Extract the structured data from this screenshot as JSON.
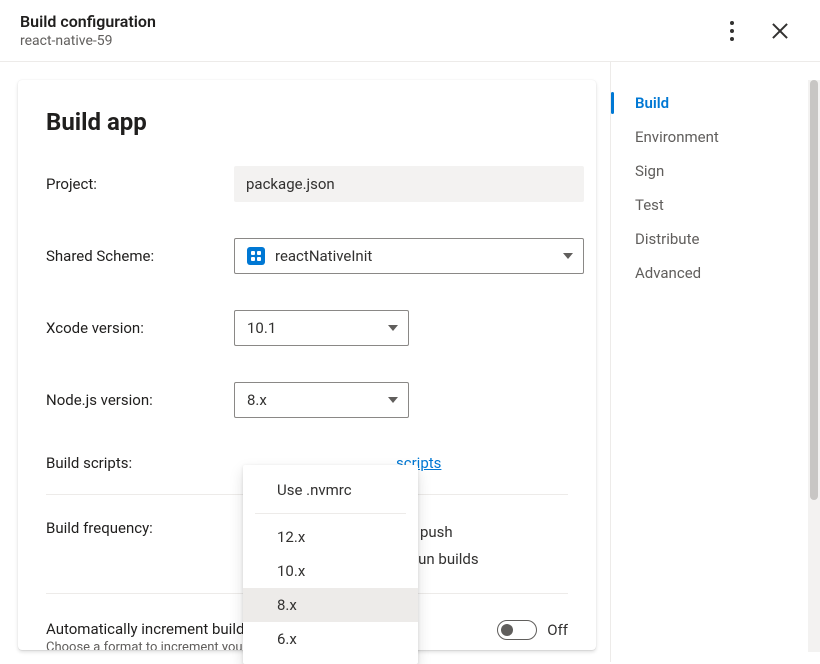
{
  "header": {
    "title": "Build configuration",
    "subtitle": "react-native-59"
  },
  "page": {
    "heading": "Build app"
  },
  "form": {
    "project": {
      "label": "Project:",
      "value": "package.json"
    },
    "shared_scheme": {
      "label": "Shared Scheme:",
      "value": "reactNativeInit"
    },
    "xcode_version": {
      "label": "Xcode version:",
      "value": "10.1"
    },
    "nodejs_version": {
      "label": "Node.js version:",
      "value": "8.x"
    },
    "build_scripts": {
      "label": "Build scripts:",
      "link_partial": "scripts"
    },
    "build_frequency": {
      "label": "Build frequency:",
      "line1_partial": "ery push",
      "line2_partial": "to run builds"
    },
    "auto_increment": {
      "title": "Automatically increment build number",
      "subtitle": "Choose a format to increment your builds.",
      "state": "Off"
    }
  },
  "nodejs_dropdown": {
    "first": "Use .nvmrc",
    "options": [
      "12.x",
      "10.x",
      "8.x",
      "6.x"
    ],
    "selected": "8.x"
  },
  "sidebar": {
    "items": [
      {
        "label": "Build",
        "active": true
      },
      {
        "label": "Environment",
        "active": false
      },
      {
        "label": "Sign",
        "active": false
      },
      {
        "label": "Test",
        "active": false
      },
      {
        "label": "Distribute",
        "active": false
      },
      {
        "label": "Advanced",
        "active": false
      }
    ]
  }
}
